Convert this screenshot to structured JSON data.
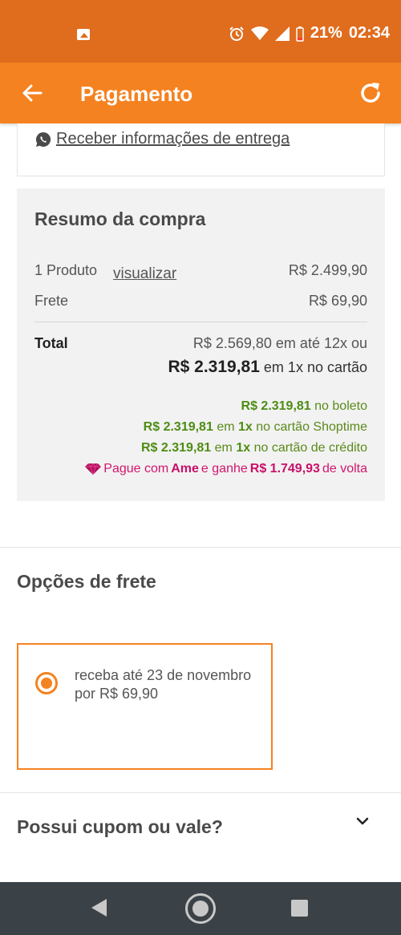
{
  "status_bar": {
    "battery": "21%",
    "time": "02:34",
    "icons": [
      "image-icon",
      "alarm-icon",
      "wifi-icon",
      "signal-icon",
      "battery-low-icon"
    ]
  },
  "app_bar": {
    "title": "Pagamento",
    "back_icon": "arrow-left-icon",
    "refresh_icon": "refresh-icon"
  },
  "delivery_info": {
    "link": "Receber informações de entrega",
    "icon": "whatsapp-icon"
  },
  "summary": {
    "title": "Resumo da compra",
    "produto_label": "1 Produto",
    "produto_link": "visualizar",
    "produto_value": "R$ 2.499,90",
    "frete_label": "Frete",
    "frete_value": "R$ 69,90",
    "total_label": "Total",
    "total_line1": "R$ 2.569,80 em até 12x ou",
    "total_amount": "R$ 2.319,81",
    "total_suffix": "em 1x no cartão",
    "options": {
      "boleto_amount": "R$ 2.319,81",
      "boleto_text": "no boleto",
      "shoptime_amount": "R$ 2.319,81",
      "shoptime_mid": "em",
      "shoptime_times": "1x",
      "shoptime_text": "no cartão Shoptime",
      "credito_amount": "R$ 2.319,81",
      "credito_mid": "em",
      "credito_times": "1x",
      "credito_text": "no cartão de crédito",
      "ame_prefix": "Pague com",
      "ame_brand": "Ame",
      "ame_mid": "e ganhe",
      "ame_amount": "R$ 1.749,93",
      "ame_suffix": "de volta"
    },
    "colors": {
      "green": "#4e8c13",
      "pink": "#c8106a"
    }
  },
  "frete": {
    "title": "Opções de frete",
    "option_text": "receba até 23 de novembro por R$ 69,90",
    "selected": true
  },
  "cupom": {
    "title": "Possui cupom ou vale?",
    "icon": "chevron-down-icon"
  },
  "theme": {
    "primary": "#f58220",
    "status": "#e06c1e"
  }
}
